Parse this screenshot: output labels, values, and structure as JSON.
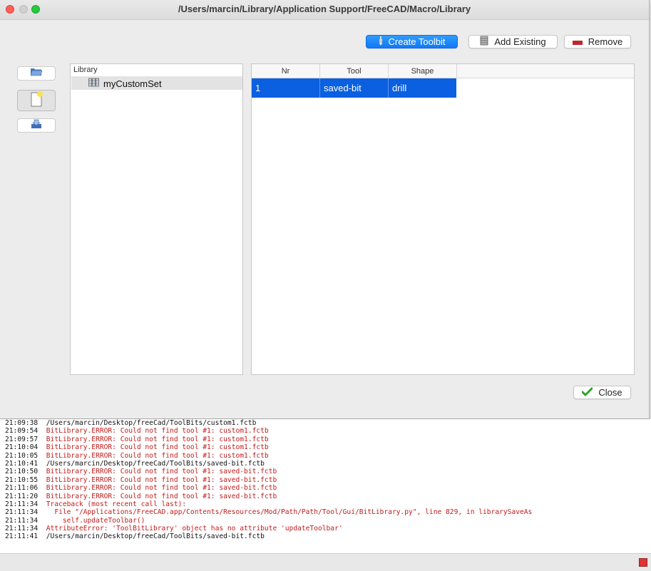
{
  "window": {
    "title": "/Users/marcin/Library/Application Support/FreeCAD/Macro/Library"
  },
  "toolbar": {
    "create_label": "Create Toolbit",
    "add_existing_label": "Add Existing",
    "remove_label": "Remove"
  },
  "library": {
    "header": "Library",
    "items": [
      {
        "label": "myCustomSet"
      }
    ]
  },
  "table": {
    "columns": [
      "Nr",
      "Tool",
      "Shape"
    ],
    "rows": [
      {
        "nr": "1",
        "tool": "saved-bit",
        "shape": "drill"
      }
    ]
  },
  "footer": {
    "close_label": "Close"
  },
  "console": {
    "lines": [
      {
        "time": "21:09:38",
        "text": "/Users/marcin/Desktop/freeCad/ToolBits/custom1.fctb",
        "level": "info"
      },
      {
        "time": "21:09:54",
        "text": "BitLibrary.ERROR: Could not find tool #1: custom1.fctb",
        "level": "error"
      },
      {
        "time": "21:09:57",
        "text": "BitLibrary.ERROR: Could not find tool #1: custom1.fctb",
        "level": "error"
      },
      {
        "time": "21:10:04",
        "text": "BitLibrary.ERROR: Could not find tool #1: custom1.fctb",
        "level": "error"
      },
      {
        "time": "21:10:05",
        "text": "BitLibrary.ERROR: Could not find tool #1: custom1.fctb",
        "level": "error"
      },
      {
        "time": "21:10:41",
        "text": "/Users/marcin/Desktop/freeCad/ToolBits/saved-bit.fctb",
        "level": "info"
      },
      {
        "time": "21:10:50",
        "text": "BitLibrary.ERROR: Could not find tool #1: saved-bit.fctb",
        "level": "error"
      },
      {
        "time": "21:10:55",
        "text": "BitLibrary.ERROR: Could not find tool #1: saved-bit.fctb",
        "level": "error"
      },
      {
        "time": "21:11:06",
        "text": "BitLibrary.ERROR: Could not find tool #1: saved-bit.fctb",
        "level": "error"
      },
      {
        "time": "21:11:20",
        "text": "BitLibrary.ERROR: Could not find tool #1: saved-bit.fctb",
        "level": "error"
      },
      {
        "time": "21:11:34",
        "text": "Traceback (most recent call last):",
        "level": "error"
      },
      {
        "time": "21:11:34",
        "text": "  File \"/Applications/FreeCAD.app/Contents/Resources/Mod/Path/Path/Tool/Gui/BitLibrary.py\", line 829, in librarySaveAs",
        "level": "error"
      },
      {
        "time": "21:11:34",
        "text": "    self.updateToolbar()",
        "level": "error"
      },
      {
        "time": "21:11:34",
        "text": "AttributeError: 'ToolBitLibrary' object has no attribute 'updateToolbar'",
        "level": "error"
      },
      {
        "time": "21:11:41",
        "text": "/Users/marcin/Desktop/freeCad/ToolBits/saved-bit.fctb",
        "level": "info"
      }
    ]
  },
  "colors": {
    "accent": "#1079f5",
    "error_text": "#c21b1b",
    "selection": "#0a60e0"
  },
  "icons": {
    "open_library": "folder-open-icon",
    "new_library": "new-document-icon",
    "save_library": "save-icon",
    "create_toolbit": "drill-bit-icon",
    "add_existing": "toolbit-stack-icon",
    "remove": "minus-icon",
    "close": "checkmark-icon",
    "library_item": "tool-library-icon"
  }
}
